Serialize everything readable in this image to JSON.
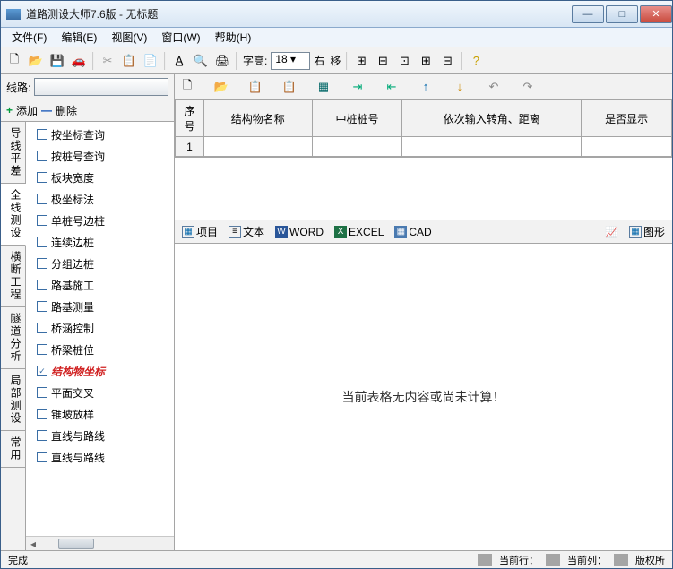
{
  "window": {
    "title": "道路测设大师7.6版 - 无标题"
  },
  "menu": {
    "file": "文件(F)",
    "edit": "编辑(E)",
    "view": "视图(V)",
    "window": "窗口(W)",
    "help": "帮助(H)"
  },
  "toolbar": {
    "fontheight_label": "字高:",
    "fontheight_value": "18",
    "right": "右",
    "move": "移"
  },
  "left": {
    "line_label": "线路:",
    "add": "添加",
    "delete": "删除",
    "vtabs": [
      "导线平差",
      "全线测设",
      "横断工程",
      "隧道分析",
      "局部测设",
      "常用"
    ],
    "active_vtab": 1,
    "tree": [
      {
        "label": "按坐标查询",
        "checked": false
      },
      {
        "label": "按桩号查询",
        "checked": false
      },
      {
        "label": "板块宽度",
        "checked": false
      },
      {
        "label": "极坐标法",
        "checked": false
      },
      {
        "label": "单桩号边桩",
        "checked": false
      },
      {
        "label": "连续边桩",
        "checked": false
      },
      {
        "label": "分组边桩",
        "checked": false
      },
      {
        "label": "路基施工",
        "checked": false
      },
      {
        "label": "路基测量",
        "checked": false
      },
      {
        "label": "桥涵控制",
        "checked": false
      },
      {
        "label": "桥梁桩位",
        "checked": false
      },
      {
        "label": "结构物坐标",
        "checked": true,
        "selected": true
      },
      {
        "label": "平面交叉",
        "checked": false
      },
      {
        "label": "锥坡放样",
        "checked": false
      },
      {
        "label": "直线与路线",
        "checked": false
      },
      {
        "label": "直线与路线",
        "checked": false
      }
    ]
  },
  "grid": {
    "headers": [
      "序号",
      "结构物名称",
      "中桩桩号",
      "依次输入转角、距离",
      "是否显示"
    ],
    "rows": [
      [
        "1",
        "",
        "",
        "",
        ""
      ]
    ]
  },
  "tabs": {
    "project": "项目",
    "text": "文本",
    "word": "WORD",
    "excel": "EXCEL",
    "cad": "CAD",
    "graphic": "图形"
  },
  "content": {
    "empty_msg": "当前表格无内容或尚未计算！"
  },
  "status": {
    "done": "完成",
    "row": "当前行：",
    "col": "当前列：",
    "copyright": "版权所"
  }
}
